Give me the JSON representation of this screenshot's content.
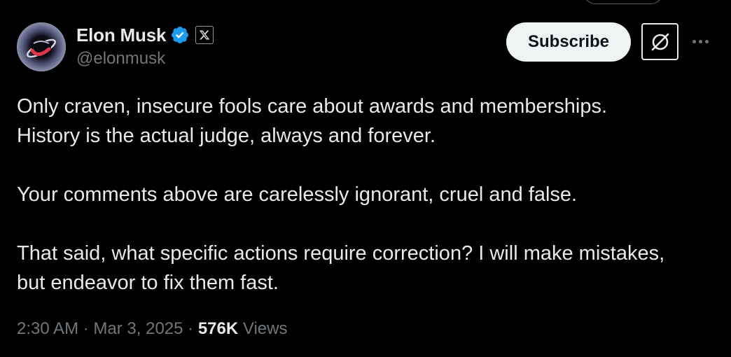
{
  "author": {
    "display_name": "Elon Musk",
    "handle": "@elonmusk",
    "verified_badge": "verified-check-icon",
    "affiliation_badge": "x-logo-icon"
  },
  "actions": {
    "subscribe_label": "Subscribe",
    "grok_icon": "grok-icon",
    "more_icon": "more-icon"
  },
  "post": {
    "lines": [
      "Only craven, insecure fools care about awards and memberships.",
      "History is the actual judge, always and forever.",
      "Your comments above are carelessly ignorant, cruel and false.",
      "That said, what specific actions require correction? I will make mistakes,",
      "but endeavor to fix them fast."
    ]
  },
  "meta": {
    "time": "2:30 AM",
    "separator": "·",
    "date": "Mar 3, 2025",
    "views_count": "576K",
    "views_label": "Views"
  },
  "colors": {
    "background": "#000000",
    "text": "#e7e9ea",
    "secondary_text": "#71767b",
    "verified_blue": "#1d9bf0",
    "button_bg": "#eff3f4"
  }
}
